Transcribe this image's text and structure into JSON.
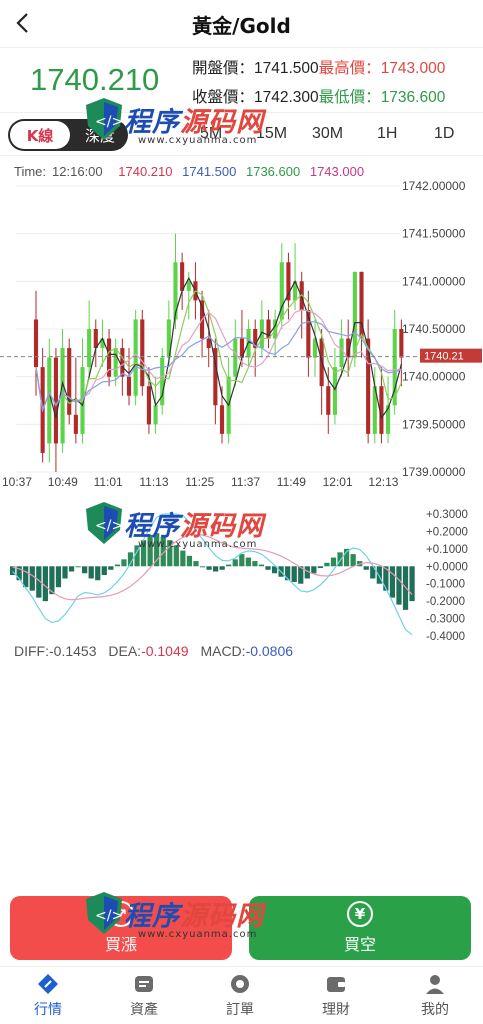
{
  "header": {
    "title": "黃金/Gold",
    "back_icon": "chevron-left-icon"
  },
  "quote": {
    "last": "1740.210",
    "open_label": "開盤價：",
    "open": "1741.500",
    "high_label": "最高價：",
    "high": "1743.000",
    "close_label": "收盤價：",
    "close": "1742.300",
    "low_label": "最低價：",
    "low": "1736.600"
  },
  "tabs": {
    "kline": "K線",
    "depth": "深度",
    "timeframes": [
      "5M",
      "15M",
      "30M",
      "1H",
      "1D"
    ]
  },
  "kinfo": {
    "time_label": "Time:",
    "time": "12:16:00",
    "v1": "1740.210",
    "v2": "1741.500",
    "v3": "1736.600",
    "v4": "1743.000"
  },
  "chart_data": [
    {
      "type": "candlestick",
      "x": [
        "10:37",
        "10:49",
        "11:01",
        "11:13",
        "11:25",
        "11:37",
        "11:49",
        "12:01",
        "12:13"
      ],
      "y_ticks": [
        "1742.00000",
        "1741.50000",
        "1741.00000",
        "1740.50000",
        "1740.00000",
        "1739.50000",
        "1739.00000"
      ],
      "ylim": [
        1739.0,
        1742.0
      ],
      "last_price_label": "1740.21",
      "candles": [
        [
          1740.6,
          1740.1,
          1740.9,
          1739.8
        ],
        [
          1740.1,
          1739.2,
          1740.3,
          1739.1
        ],
        [
          1739.3,
          1740.2,
          1740.4,
          1739.1
        ],
        [
          1740.2,
          1739.3,
          1740.3,
          1739.0
        ],
        [
          1739.3,
          1740.3,
          1740.5,
          1739.2
        ],
        [
          1740.3,
          1739.6,
          1740.4,
          1739.5
        ],
        [
          1739.6,
          1739.4,
          1740.2,
          1739.3
        ],
        [
          1739.4,
          1740.1,
          1740.4,
          1739.3
        ],
        [
          1740.1,
          1740.5,
          1740.8,
          1740.0
        ],
        [
          1740.5,
          1740.3,
          1740.6,
          1740.1
        ],
        [
          1740.3,
          1740.4,
          1740.6,
          1740.1
        ],
        [
          1740.4,
          1740.0,
          1740.5,
          1739.9
        ],
        [
          1740.0,
          1740.3,
          1740.4,
          1739.9
        ],
        [
          1740.3,
          1740.0,
          1740.4,
          1739.8
        ],
        [
          1740.0,
          1739.8,
          1740.3,
          1739.7
        ],
        [
          1739.8,
          1740.6,
          1740.7,
          1739.7
        ],
        [
          1740.6,
          1739.9,
          1740.7,
          1739.8
        ],
        [
          1739.9,
          1739.5,
          1740.1,
          1739.4
        ],
        [
          1739.5,
          1739.7,
          1740.0,
          1739.4
        ],
        [
          1739.7,
          1740.2,
          1740.3,
          1739.6
        ],
        [
          1740.2,
          1740.6,
          1740.8,
          1740.1
        ],
        [
          1740.6,
          1741.2,
          1741.5,
          1740.5
        ],
        [
          1741.2,
          1740.9,
          1741.3,
          1740.7
        ],
        [
          1740.9,
          1741.0,
          1741.1,
          1740.6
        ],
        [
          1741.0,
          1740.8,
          1741.2,
          1740.6
        ],
        [
          1740.8,
          1740.4,
          1740.9,
          1740.2
        ],
        [
          1740.4,
          1740.3,
          1740.7,
          1740.1
        ],
        [
          1740.3,
          1739.7,
          1740.4,
          1739.5
        ],
        [
          1739.7,
          1739.4,
          1739.9,
          1739.3
        ],
        [
          1739.4,
          1740.0,
          1740.2,
          1739.3
        ],
        [
          1740.0,
          1740.4,
          1740.6,
          1739.9
        ],
        [
          1740.4,
          1740.2,
          1740.7,
          1740.1
        ],
        [
          1740.2,
          1740.5,
          1740.6,
          1740.1
        ],
        [
          1740.5,
          1740.3,
          1740.6,
          1740.0
        ],
        [
          1740.3,
          1740.6,
          1740.8,
          1740.2
        ],
        [
          1740.6,
          1740.4,
          1740.7,
          1740.3
        ],
        [
          1740.4,
          1740.6,
          1740.7,
          1740.2
        ],
        [
          1740.6,
          1741.2,
          1741.4,
          1740.5
        ],
        [
          1741.2,
          1740.8,
          1741.3,
          1740.6
        ],
        [
          1740.8,
          1741.0,
          1741.4,
          1740.7
        ],
        [
          1741.0,
          1740.7,
          1741.1,
          1740.4
        ],
        [
          1740.7,
          1740.2,
          1740.9,
          1740.0
        ],
        [
          1740.2,
          1740.4,
          1740.6,
          1740.0
        ],
        [
          1740.4,
          1739.9,
          1740.5,
          1739.6
        ],
        [
          1739.9,
          1739.6,
          1740.1,
          1739.4
        ],
        [
          1739.6,
          1740.1,
          1740.3,
          1739.5
        ],
        [
          1740.1,
          1740.4,
          1740.6,
          1740.0
        ],
        [
          1740.4,
          1740.2,
          1740.6,
          1740.0
        ],
        [
          1740.2,
          1741.1,
          1741.1,
          1740.1
        ],
        [
          1741.1,
          1740.4,
          1741.1,
          1740.2
        ],
        [
          1740.4,
          1739.4,
          1740.6,
          1739.3
        ],
        [
          1739.4,
          1739.9,
          1740.1,
          1739.3
        ],
        [
          1739.9,
          1739.4,
          1740.1,
          1739.3
        ],
        [
          1739.4,
          1739.7,
          1740.0,
          1739.3
        ],
        [
          1739.7,
          1740.5,
          1740.7,
          1739.6
        ],
        [
          1740.5,
          1740.2,
          1740.6,
          1739.9
        ]
      ]
    },
    {
      "type": "bar",
      "y_ticks": [
        "+0.3000",
        "+0.2000",
        "+0.1000",
        "+0.0000",
        "-0.1000",
        "-0.2000",
        "-0.3000",
        "-0.4000"
      ],
      "ylim": [
        -0.4,
        0.3
      ],
      "values": [
        -0.05,
        -0.08,
        -0.12,
        -0.14,
        -0.18,
        -0.2,
        -0.16,
        -0.12,
        -0.07,
        -0.03,
        0.0,
        -0.04,
        -0.07,
        -0.08,
        -0.05,
        -0.02,
        0.01,
        0.04,
        0.08,
        0.12,
        0.15,
        0.18,
        0.19,
        0.17,
        0.15,
        0.12,
        0.09,
        0.06,
        0.03,
        0.0,
        -0.02,
        -0.03,
        -0.02,
        0.01,
        0.04,
        0.07,
        0.05,
        0.03,
        0.01,
        -0.02,
        -0.04,
        -0.06,
        -0.08,
        -0.09,
        -0.1,
        -0.07,
        -0.04,
        -0.01,
        0.02,
        0.05,
        0.08,
        0.1,
        0.07,
        0.03,
        -0.02,
        -0.07,
        -0.1,
        -0.14,
        -0.18,
        -0.22,
        -0.25,
        -0.2
      ]
    }
  ],
  "macd": {
    "diff_label": "DIFF:",
    "diff": "-0.1453",
    "dea_label": "DEA:",
    "dea": "-0.1049",
    "macd_label": "MACD:",
    "macd": "-0.0806"
  },
  "watermark": {
    "text_a": "程序",
    "text_b": "源码网",
    "url": "www.cxyuanma.com"
  },
  "buttons": {
    "buy": "買漲",
    "sell": "買空",
    "sell_icon_glyph": "¥"
  },
  "nav": [
    {
      "label": "行情",
      "icon": "compass-icon"
    },
    {
      "label": "資產",
      "icon": "wallet-card-icon"
    },
    {
      "label": "訂單",
      "icon": "order-icon"
    },
    {
      "label": "理財",
      "icon": "finance-icon"
    },
    {
      "label": "我的",
      "icon": "user-icon"
    }
  ],
  "colors": {
    "up": "#e2473f",
    "down": "#2f9a47",
    "bull_candle": "#5bd44a",
    "bear_candle": "#b02a2a",
    "accent": "#1d5fd1"
  }
}
